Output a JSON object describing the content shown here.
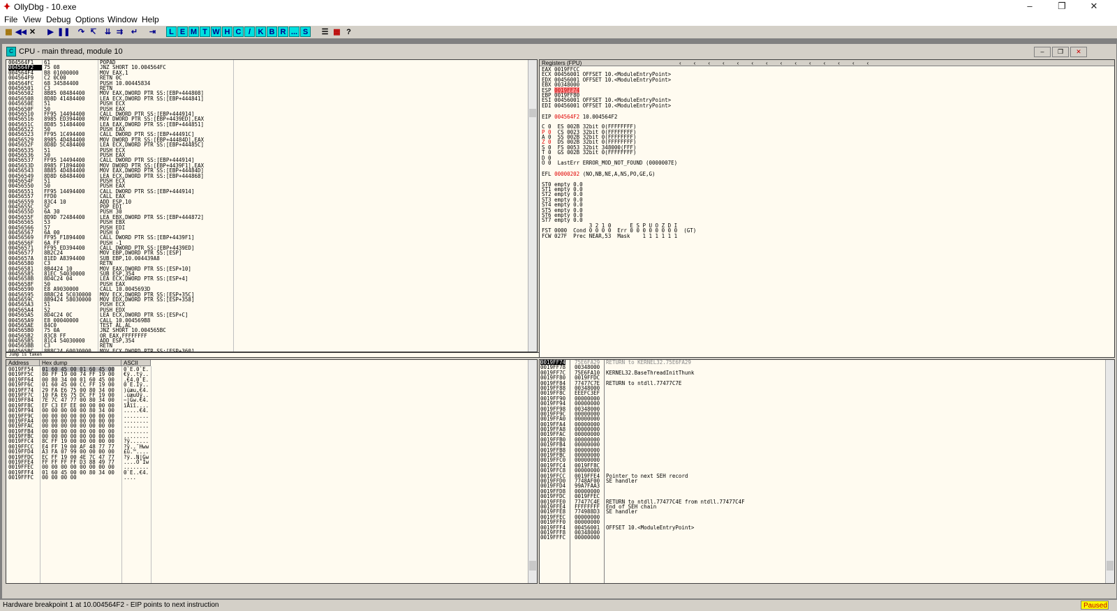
{
  "window": {
    "title": "OllyDbg - 10.exe"
  },
  "menu": [
    "File",
    "View",
    "Debug",
    "Options",
    "Window",
    "Help"
  ],
  "toolbar": {
    "icons": [
      "open-icon",
      "restart-icon",
      "close-icon",
      "run-icon",
      "pause-icon",
      "step-into-icon",
      "step-over-icon",
      "trace-into-icon",
      "trace-over-icon",
      "execute-till-return-icon",
      "go-to-icon"
    ],
    "letters": [
      "L",
      "E",
      "M",
      "T",
      "W",
      "H",
      "C",
      "/",
      "K",
      "B",
      "R",
      "...",
      "S"
    ],
    "trailing": [
      "list-icon",
      "grid-icon",
      "?"
    ]
  },
  "child": {
    "title": "CPU - main thread, module 10"
  },
  "disasm": {
    "rows": [
      {
        "addr": "004564F1",
        "hex": "61",
        "cmd": "POPAD"
      },
      {
        "addr": "004564F2",
        "hex": "75 08",
        "cmd": "JNZ SHORT 10.004564FC",
        "selected": true
      },
      {
        "addr": "004564F4",
        "hex": "B8 01000000",
        "cmd": "MOV EAX,1"
      },
      {
        "addr": "004564F9",
        "hex": "C2 0C00",
        "cmd": "RETN 0C"
      },
      {
        "addr": "004564FC",
        "hex": "68 34584400",
        "cmd": "PUSH 10.00445834"
      },
      {
        "addr": "00456501",
        "hex": "C3",
        "cmd": "RETN"
      },
      {
        "addr": "00456502",
        "hex": "8B85 08484400",
        "cmd": "MOV EAX,DWORD PTR SS:[EBP+444808]"
      },
      {
        "addr": "00456508",
        "hex": "8D8D 41484400",
        "cmd": "LEA ECX,DWORD PTR SS:[EBP+444841]"
      },
      {
        "addr": "0045650E",
        "hex": "51",
        "cmd": "PUSH ECX"
      },
      {
        "addr": "0045650F",
        "hex": "50",
        "cmd": "PUSH EAX"
      },
      {
        "addr": "00456510",
        "hex": "FF95 14494400",
        "cmd": "CALL DWORD PTR SS:[EBP+444914]"
      },
      {
        "addr": "00456516",
        "hex": "8985 ED394400",
        "cmd": "MOV DWORD PTR SS:[EBP+4439ED],EAX"
      },
      {
        "addr": "0045651C",
        "hex": "8D85 51484400",
        "cmd": "LEA EAX,DWORD PTR SS:[EBP+444851]"
      },
      {
        "addr": "00456522",
        "hex": "50",
        "cmd": "PUSH EAX"
      },
      {
        "addr": "00456523",
        "hex": "FF95 1C494400",
        "cmd": "CALL DWORD PTR SS:[EBP+44491C]"
      },
      {
        "addr": "00456529",
        "hex": "8985 4D484400",
        "cmd": "MOV DWORD PTR SS:[EBP+44484D],EAX"
      },
      {
        "addr": "0045652F",
        "hex": "8D8D 5C484400",
        "cmd": "LEA ECX,DWORD PTR SS:[EBP+44485C]"
      },
      {
        "addr": "00456535",
        "hex": "51",
        "cmd": "PUSH ECX"
      },
      {
        "addr": "00456536",
        "hex": "50",
        "cmd": "PUSH EAX"
      },
      {
        "addr": "00456537",
        "hex": "FF95 14494400",
        "cmd": "CALL DWORD PTR SS:[EBP+444914]"
      },
      {
        "addr": "0045653D",
        "hex": "8985 F1894400",
        "cmd": "MOV DWORD PTR SS:[EBP+4439F1],EAX"
      },
      {
        "addr": "00456543",
        "hex": "8B85 4D484400",
        "cmd": "MOV EAX,DWORD PTR SS:[EBP+44484D]"
      },
      {
        "addr": "00456549",
        "hex": "8D8D 68484400",
        "cmd": "LEA ECX,DWORD PTR SS:[EBP+444868]"
      },
      {
        "addr": "0045654F",
        "hex": "51",
        "cmd": "PUSH ECX"
      },
      {
        "addr": "00456550",
        "hex": "50",
        "cmd": "PUSH EAX"
      },
      {
        "addr": "00456551",
        "hex": "FF95 14494400",
        "cmd": "CALL DWORD PTR SS:[EBP+444914]"
      },
      {
        "addr": "00456557",
        "hex": "FFD0",
        "cmd": "CALL EAX"
      },
      {
        "addr": "00456559",
        "hex": "83C4 10",
        "cmd": "ADD ESP,10"
      },
      {
        "addr": "0045655C",
        "hex": "5F",
        "cmd": "POP EDI"
      },
      {
        "addr": "0045655D",
        "hex": "6A 30",
        "cmd": "PUSH 30"
      },
      {
        "addr": "0045655F",
        "hex": "8D9D 72484400",
        "cmd": "LEA EBX,DWORD PTR SS:[EBP+444872]"
      },
      {
        "addr": "00456565",
        "hex": "53",
        "cmd": "PUSH EBX"
      },
      {
        "addr": "00456566",
        "hex": "57",
        "cmd": "PUSH EDI"
      },
      {
        "addr": "00456567",
        "hex": "6A 00",
        "cmd": "PUSH 0"
      },
      {
        "addr": "00456569",
        "hex": "FF95 F1894400",
        "cmd": "CALL DWORD PTR SS:[EBP+4439F1]"
      },
      {
        "addr": "0045656F",
        "hex": "6A FF",
        "cmd": "PUSH -1"
      },
      {
        "addr": "00456571",
        "hex": "FF95 ED394400",
        "cmd": "CALL DWORD PTR SS:[EBP+4439ED]"
      },
      {
        "addr": "00456577",
        "hex": "8B2C24",
        "cmd": "MOV EBP,DWORD PTR SS:[ESP]"
      },
      {
        "addr": "0045657A",
        "hex": "81ED A8394400",
        "cmd": "SUB EBP,10.004439A8"
      },
      {
        "addr": "00456580",
        "hex": "C3",
        "cmd": "RETN"
      },
      {
        "addr": "00456581",
        "hex": "8B4424 10",
        "cmd": "MOV EAX,DWORD PTR SS:[ESP+10]"
      },
      {
        "addr": "00456585",
        "hex": "81EC 54030000",
        "cmd": "SUB ESP,354"
      },
      {
        "addr": "0045658B",
        "hex": "8D4C24 04",
        "cmd": "LEA ECX,DWORD PTR SS:[ESP+4]"
      },
      {
        "addr": "0045658F",
        "hex": "50",
        "cmd": "PUSH EAX"
      },
      {
        "addr": "00456590",
        "hex": "E8 A9030000",
        "cmd": "CALL 10.0045693D"
      },
      {
        "addr": "00456595",
        "hex": "8B8C24 5C030000",
        "cmd": "MOV ECX,DWORD PTR SS:[ESP+35C]"
      },
      {
        "addr": "0045659C",
        "hex": "8B9424 58030000",
        "cmd": "MOV EDX,DWORD PTR SS:[ESP+358]"
      },
      {
        "addr": "004565A3",
        "hex": "51",
        "cmd": "PUSH ECX"
      },
      {
        "addr": "004565A4",
        "hex": "52",
        "cmd": "PUSH EDX"
      },
      {
        "addr": "004565A5",
        "hex": "8D4C24 0C",
        "cmd": "LEA ECX,DWORD PTR SS:[ESP+C]"
      },
      {
        "addr": "004565A9",
        "hex": "E8 00040000",
        "cmd": "CALL 10.004569B8"
      },
      {
        "addr": "004565AE",
        "hex": "84C0",
        "cmd": "TEST AL,AL"
      },
      {
        "addr": "004565B0",
        "hex": "75 0A",
        "cmd": "JNZ SHORT 10.004565BC"
      },
      {
        "addr": "004565B2",
        "hex": "83C8 FF",
        "cmd": "OR EAX,FFFFFFFF"
      },
      {
        "addr": "004565B5",
        "hex": "81C4 54030000",
        "cmd": "ADD ESP,354"
      },
      {
        "addr": "004565BB",
        "hex": "C3",
        "cmd": "RETN"
      },
      {
        "addr": "004565BC",
        "hex": "8B8C24 60030000",
        "cmd": "MOV ECX,DWORD PTR SS:[ESP+360]"
      }
    ],
    "info": "Jump is taken"
  },
  "registers": {
    "header": "Registers (FPU)",
    "lines": [
      {
        "t": "EAX 0019FFCC"
      },
      {
        "t": "ECX 00456001 OFFSET 10.<ModuleEntryPoint>"
      },
      {
        "t": "EDX 00456001 OFFSET 10.<ModuleEntryPoint>"
      },
      {
        "t": "EBX 00348000"
      },
      {
        "t": "ESP 0019FF74",
        "hl": "0019FF74"
      },
      {
        "t": "EBP 0019FF80"
      },
      {
        "t": "ESI 00456001 OFFSET 10.<ModuleEntryPoint>"
      },
      {
        "t": "EDI 00456001 OFFSET 10.<ModuleEntryPoint>"
      },
      {
        "t": ""
      },
      {
        "t": "EIP 004564F2 10.004564F2",
        "red": "004564F2"
      },
      {
        "t": ""
      },
      {
        "t": "C 0  ES 002B 32bit 0(FFFFFFFF)"
      },
      {
        "t": "P 0  CS 0023 32bit 0(FFFFFFFF)",
        "red": "P 0"
      },
      {
        "t": "A 0  SS 002B 32bit 0(FFFFFFFF)"
      },
      {
        "t": "Z 0  DS 002B 32bit 0(FFFFFFFF)",
        "red": "Z 0"
      },
      {
        "t": "S 0  FS 0053 32bit 348000(FFF)"
      },
      {
        "t": "T 0  GS 002B 32bit 0(FFFFFFFF)"
      },
      {
        "t": "D 0"
      },
      {
        "t": "O 0  LastErr ERROR_MOD_NOT_FOUND (0000007E)"
      },
      {
        "t": ""
      },
      {
        "t": "EFL 00000202 (NO,NB,NE,A,NS,PO,GE,G)",
        "red": "00000202"
      },
      {
        "t": ""
      },
      {
        "t": "ST0 empty 0.0"
      },
      {
        "t": "ST1 empty 0.0"
      },
      {
        "t": "ST2 empty 0.0"
      },
      {
        "t": "ST3 empty 0.0"
      },
      {
        "t": "ST4 empty 0.0"
      },
      {
        "t": "ST5 empty 0.0"
      },
      {
        "t": "ST6 empty 0.0"
      },
      {
        "t": "ST7 empty 0.0"
      },
      {
        "t": "               3 2 1 0      E S P U O Z D I"
      },
      {
        "t": "FST 0000  Cond 0 0 0 0  Err 0 0 0 0 0 0 0 0  (GT)"
      },
      {
        "t": "FCW 027F  Prec NEAR,53  Mask    1 1 1 1 1 1"
      }
    ]
  },
  "dump": {
    "headers": {
      "address": "Address",
      "hex": "Hex dump",
      "ascii": "ASCII"
    },
    "rows": [
      {
        "a": "0019FF54",
        "h": "01 60 45 00 01 60 45 00",
        "s": "0`E.0`E."
      },
      {
        "a": "0019FF5C",
        "h": "80 FF 19 00 74 FF 19 00",
        "s": "€ÿ..tÿ.."
      },
      {
        "a": "0019FF64",
        "h": "00 80 34 00 01 60 45 00",
        "s": ".€4.0`E."
      },
      {
        "a": "0019FF6C",
        "h": "01 60 45 00 CC FF 19 00",
        "s": "0`E.Ìÿ.."
      },
      {
        "a": "0019FF74",
        "h": "29 FA E6 75 00 80 34 00",
        "s": ")úæu.€4."
      },
      {
        "a": "0019FF7C",
        "h": "10 FA E6 75 DC FF 19 00",
        "s": ".úæuÜÿ.."
      },
      {
        "a": "0019FF84",
        "h": "7E 7C 47 77 00 80 34 00",
        "s": "~|Gw.€4."
      },
      {
        "a": "0019FF8C",
        "h": "EF C3 EF EE 00 00 00 00",
        "s": "ïÃïî...."
      },
      {
        "a": "0019FF94",
        "h": "00 00 00 00 00 80 34 00",
        "s": ".....€4."
      },
      {
        "a": "0019FF9C",
        "h": "00 00 00 00 00 00 00 00",
        "s": "........"
      },
      {
        "a": "0019FFA4",
        "h": "00 00 00 00 00 00 00 00",
        "s": "........"
      },
      {
        "a": "0019FFAC",
        "h": "00 00 00 00 00 00 00 00",
        "s": "........"
      },
      {
        "a": "0019FFB4",
        "h": "00 00 00 00 00 00 00 00",
        "s": "........"
      },
      {
        "a": "0019FFBC",
        "h": "00 00 00 00 00 00 00 00",
        "s": "........"
      },
      {
        "a": "0019FFC4",
        "h": "8C FF 19 00 00 00 00 00",
        "s": "?ÿ......"
      },
      {
        "a": "0019FFCC",
        "h": "E4 FF 19 00 AF 48 77 77",
        "s": "?ÿ..¯Hww"
      },
      {
        "a": "0019FFD4",
        "h": "A3 FA 07 99 00 00 00 00",
        "s": "£ú.™...."
      },
      {
        "a": "0019FFDC",
        "h": "EC FF 19 00 4E 7C 47 77",
        "s": "?ÿ..N|Gw"
      },
      {
        "a": "0019FFE4",
        "h": "FF FF FF FF D3 88 49 77",
        "s": "....ÓˆIw"
      },
      {
        "a": "0019FFEC",
        "h": "00 00 00 00 00 00 00 00",
        "s": "........"
      },
      {
        "a": "0019FFF4",
        "h": "01 60 45 00 00 80 34 00",
        "s": "0`E..€4."
      },
      {
        "a": "0019FFFC",
        "h": "00 00 00 00",
        "s": "...."
      }
    ]
  },
  "stack": {
    "rows": [
      {
        "a": "0019FF74",
        "v": "75E6FA29",
        "c": "RETURN to KERNEL32.75E6FA29",
        "top": true
      },
      {
        "a": "0019FF78",
        "v": "00348000",
        "c": ""
      },
      {
        "a": "0019FF7C",
        "v": "75E6FA10",
        "c": "KERNEL32.BaseThreadInitThunk"
      },
      {
        "a": "0019FF80",
        "v": "0019FFDC",
        "c": ""
      },
      {
        "a": "0019FF84",
        "v": "77477C7E",
        "c": "RETURN to ntdll.77477C7E"
      },
      {
        "a": "0019FF88",
        "v": "00348000",
        "c": ""
      },
      {
        "a": "0019FF8C",
        "v": "EEEFC3EF",
        "c": ""
      },
      {
        "a": "0019FF90",
        "v": "00000000",
        "c": ""
      },
      {
        "a": "0019FF94",
        "v": "00000000",
        "c": ""
      },
      {
        "a": "0019FF98",
        "v": "00348000",
        "c": ""
      },
      {
        "a": "0019FF9C",
        "v": "00000000",
        "c": ""
      },
      {
        "a": "0019FFA0",
        "v": "00000000",
        "c": ""
      },
      {
        "a": "0019FFA4",
        "v": "00000000",
        "c": ""
      },
      {
        "a": "0019FFA8",
        "v": "00000000",
        "c": ""
      },
      {
        "a": "0019FFAC",
        "v": "00000000",
        "c": ""
      },
      {
        "a": "0019FFB0",
        "v": "00000000",
        "c": ""
      },
      {
        "a": "0019FFB4",
        "v": "00000000",
        "c": ""
      },
      {
        "a": "0019FFB8",
        "v": "00000000",
        "c": ""
      },
      {
        "a": "0019FFBC",
        "v": "00000000",
        "c": ""
      },
      {
        "a": "0019FFC0",
        "v": "00000000",
        "c": ""
      },
      {
        "a": "0019FFC4",
        "v": "0019FF8C",
        "c": ""
      },
      {
        "a": "0019FFC8",
        "v": "00000000",
        "c": ""
      },
      {
        "a": "0019FFCC",
        "v": "0019FFE4",
        "c": "Pointer to next SEH record"
      },
      {
        "a": "0019FFD0",
        "v": "7748AF00",
        "c": "SE handler"
      },
      {
        "a": "0019FFD4",
        "v": "99A7FAA3",
        "c": ""
      },
      {
        "a": "0019FFD8",
        "v": "00000000",
        "c": ""
      },
      {
        "a": "0019FFDC",
        "v": "0019FFEC",
        "c": ""
      },
      {
        "a": "0019FFE0",
        "v": "77477C4E",
        "c": "RETURN to ntdll.77477C4E from ntdll.77477C4F"
      },
      {
        "a": "0019FFE4",
        "v": "FFFFFFFF",
        "c": "End of SEH chain"
      },
      {
        "a": "0019FFE8",
        "v": "774988D3",
        "c": "SE handler"
      },
      {
        "a": "0019FFEC",
        "v": "00000000",
        "c": ""
      },
      {
        "a": "0019FFF0",
        "v": "00000000",
        "c": ""
      },
      {
        "a": "0019FFF4",
        "v": "00456001",
        "c": "OFFSET 10.<ModuleEntryPoint>"
      },
      {
        "a": "0019FFF8",
        "v": "00348000",
        "c": ""
      },
      {
        "a": "0019FFFC",
        "v": "00000000",
        "c": ""
      }
    ]
  },
  "status": {
    "message": "Hardware breakpoint 1 at 10.004564F2 - EIP points to next instruction",
    "state": "Paused"
  },
  "colors": {
    "pane_bg": "#fffbf0",
    "selection": "#000000",
    "toolbar_letters": "#00e0e0",
    "paused_bg": "#ffff00"
  }
}
